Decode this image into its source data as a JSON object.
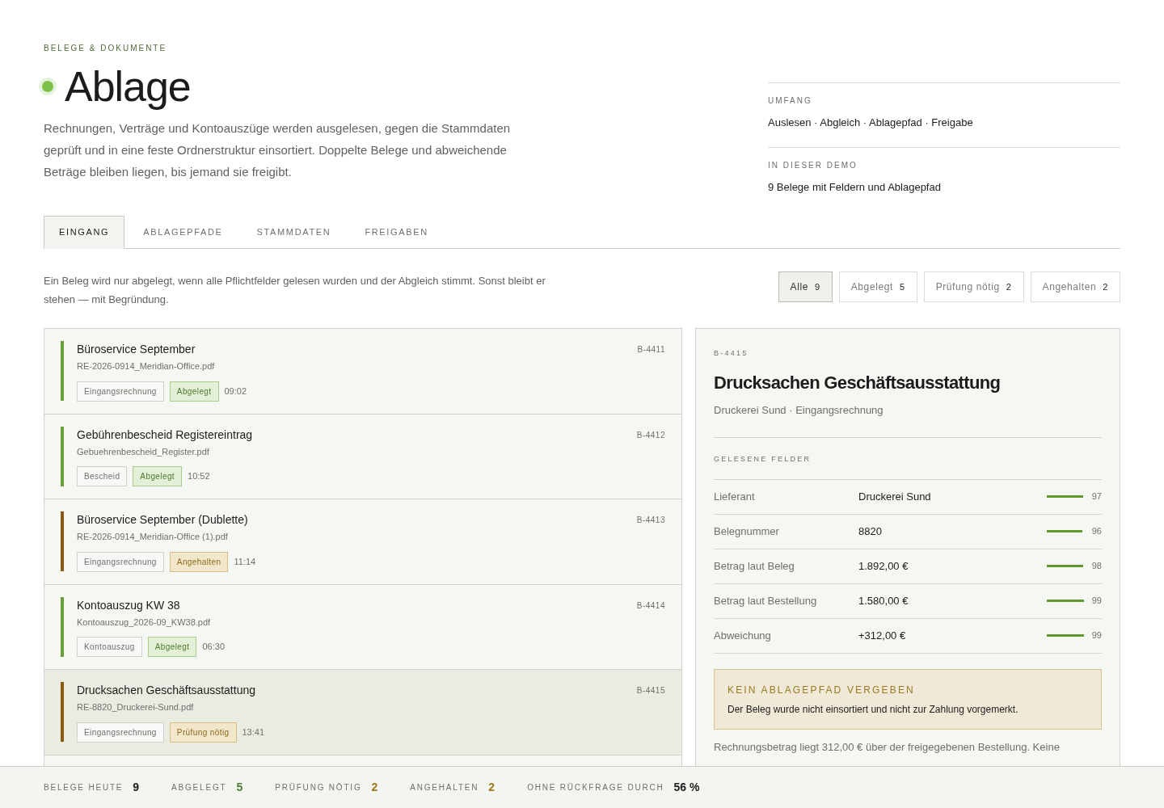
{
  "eyebrow": "BELEGE & DOKUMENTE",
  "title": "Ablage",
  "intro": "Rechnungen, Verträge und Kontoauszüge werden ausgelesen, gegen die Stammdaten geprüft und in eine feste Ordnerstruktur einsortiert. Doppelte Belege und abweichende Beträge bleiben liegen, bis jemand sie freigibt.",
  "facts": [
    {
      "label": "UMFANG",
      "value": "Auslesen · Abgleich · Ablagepfad · Freigabe"
    },
    {
      "label": "IN DIESER DEMO",
      "value": "9 Belege mit Feldern und Ablagepfad"
    }
  ],
  "tabs": [
    {
      "label": "EINGANG",
      "selected": true
    },
    {
      "label": "ABLAGEPFADE",
      "selected": false
    },
    {
      "label": "STAMMDATEN",
      "selected": false
    },
    {
      "label": "FREIGABEN",
      "selected": false
    }
  ],
  "note": "Ein Beleg wird nur abgelegt, wenn alle Pflichtfelder gelesen wurden und der Abgleich stimmt. Sonst bleibt er stehen — mit Begründung.",
  "filters": [
    {
      "label": "Alle",
      "count": "9",
      "selected": true
    },
    {
      "label": "Abgelegt",
      "count": "5",
      "selected": false
    },
    {
      "label": "Prüfung nötig",
      "count": "2",
      "selected": false
    },
    {
      "label": "Angehalten",
      "count": "2",
      "selected": false
    }
  ],
  "documents": [
    {
      "title": "Büroservice September",
      "file": "RE-2026-0914_Meridian-Office.pdf",
      "type": "Eingangsrechnung",
      "status": "Abgelegt",
      "kind": "ok",
      "time": "09:02",
      "id": "B-4411",
      "selected": false
    },
    {
      "title": "Gebührenbescheid Registereintrag",
      "file": "Gebuehrenbescheid_Register.pdf",
      "type": "Bescheid",
      "status": "Abgelegt",
      "kind": "ok",
      "time": "10:52",
      "id": "B-4412",
      "selected": false
    },
    {
      "title": "Büroservice September (Dublette)",
      "file": "RE-2026-0914_Meridian-Office (1).pdf",
      "type": "Eingangsrechnung",
      "status": "Angehalten",
      "kind": "warn",
      "time": "11:14",
      "id": "B-4413",
      "selected": false
    },
    {
      "title": "Kontoauszug KW 38",
      "file": "Kontoauszug_2026-09_KW38.pdf",
      "type": "Kontoauszug",
      "status": "Abgelegt",
      "kind": "ok",
      "time": "06:30",
      "id": "B-4414",
      "selected": false
    },
    {
      "title": "Drucksachen Geschäftsausstattung",
      "file": "RE-8820_Druckerei-Sund.pdf",
      "type": "Eingangsrechnung",
      "status": "Prüfung nötig",
      "kind": "warn",
      "time": "13:41",
      "id": "B-4415",
      "selected": true
    }
  ],
  "detail": {
    "id": "B-4415",
    "title": "Drucksachen Geschäftsausstattung",
    "subtitle": "Druckerei Sund · Eingangsrechnung",
    "fields_heading": "GELESENE FELDER",
    "fields": [
      {
        "label": "Lieferant",
        "value": "Druckerei Sund",
        "level": 0.97,
        "reading": "97"
      },
      {
        "label": "Belegnummer",
        "value": "8820",
        "level": 0.96,
        "reading": "96"
      },
      {
        "label": "Betrag laut Beleg",
        "value": "1.892,00 €",
        "level": 0.98,
        "reading": "98"
      },
      {
        "label": "Betrag laut Bestellung",
        "value": "1.580,00 €",
        "level": 0.99,
        "reading": "99"
      },
      {
        "label": "Abweichung",
        "value": "+312,00 €",
        "level": 0.99,
        "reading": "99"
      }
    ],
    "alert": {
      "title": "KEIN ABLAGEPFAD VERGEBEN",
      "text": "Der Beleg wurde nicht einsortiert und nicht zur Zahlung vorgemerkt."
    },
    "reason": "Rechnungsbetrag liegt 312,00 € über der freigegebenen Bestellung. Keine"
  },
  "stats": [
    {
      "label": "BELEGE HEUTE",
      "value": "9",
      "kind": "neutral"
    },
    {
      "label": "ABGELEGT",
      "value": "5",
      "kind": "ok"
    },
    {
      "label": "PRÜFUNG NÖTIG",
      "value": "2",
      "kind": "warn"
    },
    {
      "label": "ANGEHALTEN",
      "value": "2",
      "kind": "warn"
    },
    {
      "label": "OHNE RÜCKFRAGE DURCH",
      "value": "56 %",
      "kind": "neutral"
    }
  ]
}
